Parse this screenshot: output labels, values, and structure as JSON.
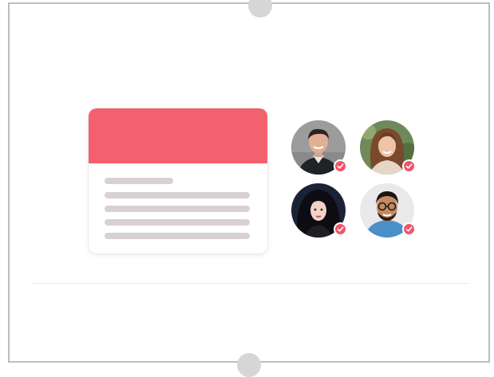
{
  "colors": {
    "card_header": "#f3616f",
    "placeholder_line": "#d9d0d3",
    "check_badge": "#f1546a",
    "handle": "#d6d6d6",
    "frame_border": "#bdbdbd"
  },
  "card": {
    "header_icon": "none",
    "content_lines": 5
  },
  "avatars": [
    {
      "name": "avatar-man-dark-jacket",
      "verified": true
    },
    {
      "name": "avatar-woman-curly-hair",
      "verified": true
    },
    {
      "name": "avatar-woman-black-hair",
      "verified": true
    },
    {
      "name": "avatar-man-glasses",
      "verified": true
    }
  ],
  "icons": {
    "check": "check-badge-icon",
    "resize_handle": "resize-handle-icon"
  }
}
